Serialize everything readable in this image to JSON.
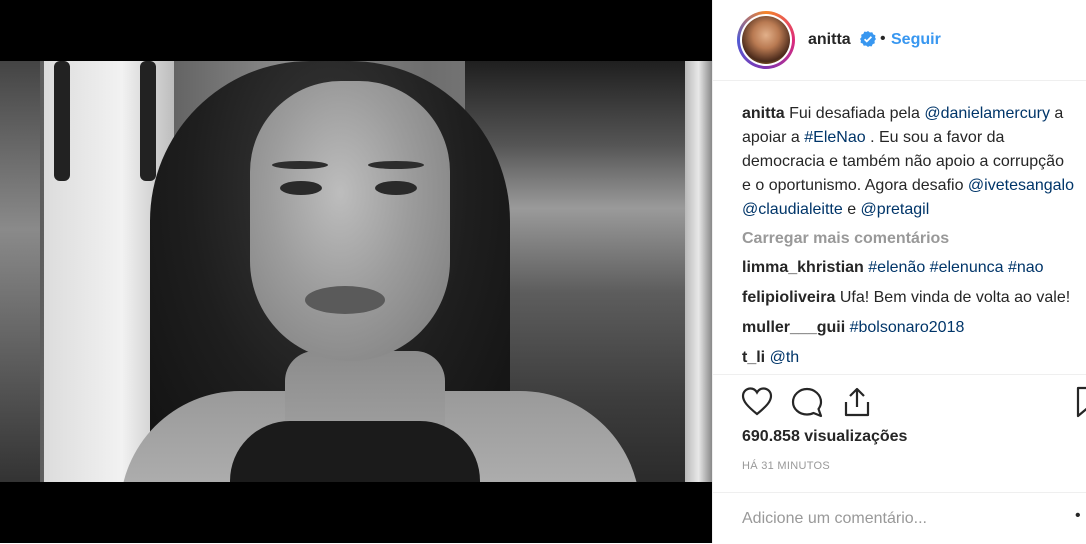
{
  "header": {
    "username": "anitta",
    "separator": "•",
    "follow_label": "Seguir"
  },
  "caption": {
    "username": "anitta",
    "parts": [
      "Fui desafiada pela ",
      "@danielamercury",
      " a apoiar a ",
      "#EleNao",
      " . Eu sou a favor da democracia e também não apoio a corrupção e o oportunismo. Agora desafio ",
      "@ivetesangalo",
      " ",
      "@claudialeitte",
      " e ",
      "@pretagil"
    ]
  },
  "load_more": "Carregar mais comentários",
  "comments": [
    {
      "user": "limma_khristian",
      "text": "#elenão #elenunca #nao"
    },
    {
      "user": "felipioliveira",
      "text": "Ufa! Bem vinda de volta ao vale!"
    },
    {
      "user": "muller___guii",
      "text": "#bolsonaro2018"
    },
    {
      "user": "t_li",
      "text": "@th"
    }
  ],
  "views": "690.858 visualizações",
  "timestamp": "HÁ 31 MINUTOS",
  "add_comment": {
    "placeholder": "Adicione um comentário..."
  },
  "more_label": "•",
  "colors": {
    "link": "#003569",
    "follow": "#3897f0",
    "muted": "#999999"
  },
  "icons": [
    "heart-icon",
    "comment-icon",
    "share-icon",
    "bookmark-icon",
    "verified-icon"
  ]
}
